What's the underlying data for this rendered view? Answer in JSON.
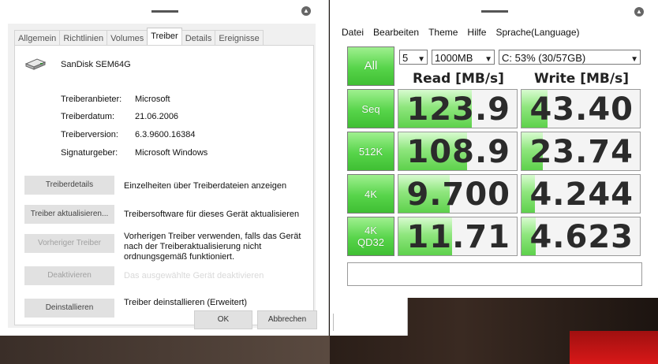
{
  "dialog": {
    "tabs": [
      "Allgemein",
      "Richtlinien",
      "Volumes",
      "Treiber",
      "Details",
      "Ereignisse"
    ],
    "active_tab": "Treiber",
    "device_name": "SanDisk SEM64G",
    "info": [
      {
        "label": "Treiberanbieter:",
        "value": "Microsoft"
      },
      {
        "label": "Treiberdatum:",
        "value": "21.06.2006"
      },
      {
        "label": "Treiberversion:",
        "value": "6.3.9600.16384"
      },
      {
        "label": "Signaturgeber:",
        "value": "Microsoft Windows"
      }
    ],
    "actions": [
      {
        "button": "Treiberdetails",
        "desc": "Einzelheiten über Treiberdateien anzeigen",
        "enabled": true
      },
      {
        "button": "Treiber aktualisieren...",
        "desc": "Treibersoftware für dieses Gerät aktualisieren",
        "enabled": true
      },
      {
        "button": "Vorheriger Treiber",
        "desc": "Vorherigen Treiber verwenden, falls das Gerät nach der Treiberaktualisierung nicht ordnungsgemäß funktioniert.",
        "enabled": false
      },
      {
        "button": "Deaktivieren",
        "desc": "Das ausgewählte Gerät deaktivieren",
        "enabled": false
      },
      {
        "button": "Deinstallieren",
        "desc": "Treiber deinstallieren (Erweitert)",
        "enabled": true
      }
    ],
    "ok_label": "OK",
    "cancel_label": "Abbrechen"
  },
  "cdm": {
    "menu": [
      "Datei",
      "Bearbeiten",
      "Theme",
      "Hilfe",
      "Sprache(Language)"
    ],
    "all_label": "All",
    "count": "5",
    "size": "1000MB",
    "drive": "C: 53% (30/57GB)",
    "read_header": "Read [MB/s]",
    "write_header": "Write [MB/s]",
    "rows": [
      {
        "label": "Seq",
        "sub": "",
        "read": "123.9",
        "write": "43.40",
        "read_fill": 0.62,
        "write_fill": 0.22
      },
      {
        "label": "512K",
        "sub": "",
        "read": "108.9",
        "write": "23.74",
        "read_fill": 0.58,
        "write_fill": 0.18
      },
      {
        "label": "4K",
        "sub": "",
        "read": "9.700",
        "write": "4.244",
        "read_fill": 0.43,
        "write_fill": 0.11
      },
      {
        "label": "4K",
        "sub": "QD32",
        "read": "11.71",
        "write": "4.623",
        "read_fill": 0.45,
        "write_fill": 0.12
      }
    ],
    "colors": {
      "accent_green": "#57d44a"
    }
  }
}
